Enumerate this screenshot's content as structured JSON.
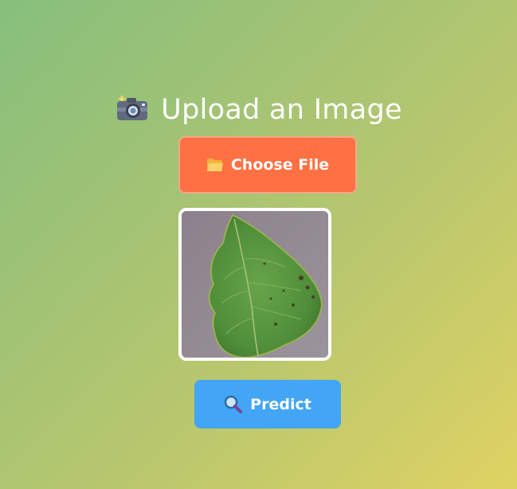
{
  "upload": {
    "title": "Upload an Image",
    "title_icon": "camera-icon",
    "choose_file_label": "Choose File",
    "choose_file_icon": "folder-icon",
    "preview_image": "leaf-image",
    "predict_label": "Predict",
    "predict_icon": "magnifier-icon"
  },
  "colors": {
    "background_start": "#86bf7d",
    "background_end": "#dfd262",
    "choose_button": "#ff7043",
    "predict_button": "#42a5f5",
    "text": "#ffffff"
  }
}
